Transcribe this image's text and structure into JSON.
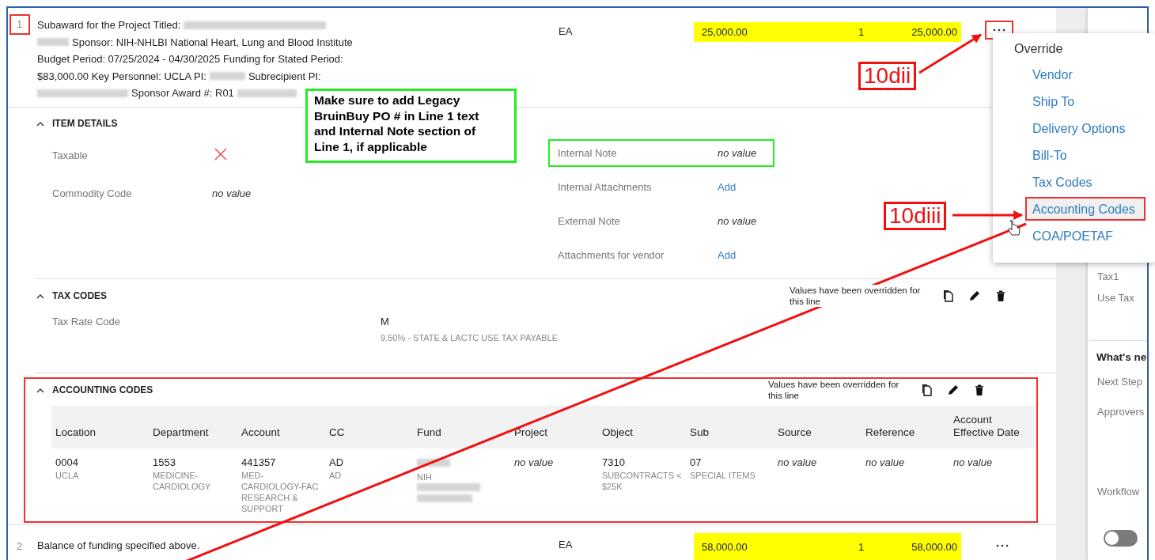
{
  "line_items": [
    {
      "number": "1",
      "boxed": true,
      "description": [
        [
          {
            "kind": "text",
            "text": "Subaward for the Project Titled:"
          },
          {
            "kind": "redacted"
          }
        ],
        [
          {
            "kind": "redacted"
          },
          {
            "kind": "text",
            "text": "Sponsor: NIH-NHLBI National Heart, Lung and Blood Institute"
          }
        ],
        [
          {
            "kind": "text",
            "text": "Budget Period: 07/25/2024 - 04/30/2025 Funding for Stated Period:"
          }
        ],
        [
          {
            "kind": "text",
            "text": "$83,000.00 Key Personnel: UCLA PI:"
          },
          {
            "kind": "redacted"
          },
          {
            "kind": "text",
            "text": "Subrecipient PI:"
          }
        ],
        [
          {
            "kind": "redacted"
          },
          {
            "kind": "text",
            "text": "Sponsor Award #: R01"
          },
          {
            "kind": "redacted"
          }
        ]
      ],
      "unit": "EA",
      "unit_price": "25,000.00",
      "quantity": "1",
      "total": "25,000.00",
      "highlighted": true,
      "menu_boxed": true
    },
    {
      "number": "2",
      "boxed": false,
      "description": [
        [
          {
            "kind": "text",
            "text": "Balance of funding specified above."
          }
        ]
      ],
      "unit": "EA",
      "unit_price": "58,000.00",
      "quantity": "1",
      "total": "58,000.00",
      "highlighted": true,
      "menu_boxed": false
    }
  ],
  "item_details": {
    "title": "ITEM DETAILS",
    "expanded": true,
    "left_fields": [
      {
        "label": "Taxable",
        "kind": "boolean",
        "on": false
      },
      {
        "label": "Commodity Code",
        "kind": "empty",
        "value": "no value"
      }
    ],
    "right_fields": [
      {
        "label": "Internal Note",
        "kind": "empty",
        "value": "no value",
        "boxed": true
      },
      {
        "label": "Internal Attachments",
        "kind": "link",
        "value": "Add",
        "boxed": false
      },
      {
        "label": "External Note",
        "kind": "empty",
        "value": "no value",
        "boxed": false
      },
      {
        "label": "Attachments for vendor",
        "kind": "link",
        "value": "Add",
        "boxed": false
      }
    ]
  },
  "tax_codes": {
    "title": "TAX CODES",
    "expanded": true,
    "override_note": "Values have been overridden for this line",
    "fields": [
      {
        "label": "Tax Rate Code",
        "value": "M",
        "subtext": "9.50% - STATE & LACTC USE TAX PAYABLE"
      }
    ]
  },
  "accounting_codes": {
    "title": "ACCOUNTING CODES",
    "expanded": true,
    "boxed": true,
    "override_note": "Values have been overridden for this line",
    "columns": [
      "Location",
      "Department",
      "Account",
      "CC",
      "Fund",
      "Project",
      "Object",
      "Sub",
      "Source",
      "Reference",
      "Account Effective Date"
    ],
    "rows": [
      [
        {
          "kind": "text",
          "value": "0004",
          "subtext": "UCLA"
        },
        {
          "kind": "text",
          "value": "1553",
          "subtext": "MEDICINE-CARDIOLOGY"
        },
        {
          "kind": "text",
          "value": "441357",
          "subtext": "MED-CARDIOLOGY-FAC RESEARCH & SUPPORT"
        },
        {
          "kind": "text",
          "value": "AD",
          "subtext": "AD"
        },
        {
          "kind": "redacted",
          "subtext": "NIH"
        },
        {
          "kind": "empty",
          "value": "no value"
        },
        {
          "kind": "text",
          "value": "7310",
          "subtext": "SUBCONTRACTS < $25K"
        },
        {
          "kind": "text",
          "value": "07",
          "subtext": "SPECIAL ITEMS"
        },
        {
          "kind": "empty",
          "value": "no value"
        },
        {
          "kind": "empty",
          "value": "no value"
        },
        {
          "kind": "empty",
          "value": "no value"
        }
      ]
    ]
  },
  "side_panel": {
    "labels": [
      "Tax1",
      "Use Tax"
    ],
    "heading": "What's ne",
    "fields": [
      "Next Step",
      "Approvers",
      "Workflow"
    ],
    "toggle": {
      "on": false
    }
  },
  "override_menu": {
    "title": "Override",
    "items": [
      {
        "label": "Vendor",
        "hovered": false,
        "boxed": false
      },
      {
        "label": "Ship To",
        "hovered": false,
        "boxed": false
      },
      {
        "label": "Delivery Options",
        "hovered": false,
        "boxed": false
      },
      {
        "label": "Bill-To",
        "hovered": false,
        "boxed": false
      },
      {
        "label": "Tax Codes",
        "hovered": false,
        "boxed": false
      },
      {
        "label": "Accounting Codes",
        "hovered": true,
        "boxed": true
      },
      {
        "label": "COA/POETAF",
        "hovered": false,
        "boxed": false
      }
    ]
  },
  "annotations": {
    "note": "Make sure to add Legacy BruinBuy PO # in Line 1 text and Internal Note section of Line 1, if applicable",
    "callouts": [
      "10dii",
      "10diii"
    ]
  }
}
